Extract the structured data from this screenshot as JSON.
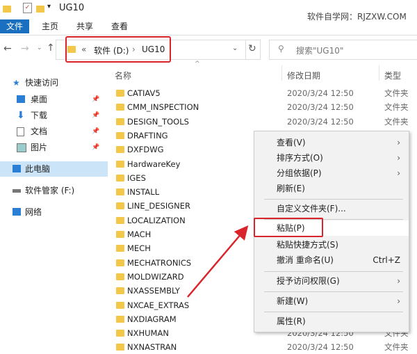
{
  "title_bar": {
    "title": "UG10",
    "watermark": "软件自学网：RJZXW.COM"
  },
  "ribbon": {
    "tabs": [
      "文件",
      "主页",
      "共享",
      "查看"
    ]
  },
  "address": {
    "prefix": "«",
    "segments": [
      "软件 (D:)",
      "UG10"
    ],
    "search_placeholder": "搜索\"UG10\""
  },
  "columns": {
    "name": "名称",
    "date": "修改日期",
    "type": "类型"
  },
  "sidebar": {
    "items": [
      {
        "label": "快速访问",
        "icon": "star-icon"
      },
      {
        "label": "桌面",
        "icon": "desktop-icon",
        "pinned": true
      },
      {
        "label": "下载",
        "icon": "download-icon",
        "pinned": true
      },
      {
        "label": "文档",
        "icon": "document-icon",
        "pinned": true
      },
      {
        "label": "图片",
        "icon": "picture-icon",
        "pinned": true
      },
      {
        "label": "此电脑",
        "icon": "computer-icon"
      },
      {
        "label": "软件管家 (F:)",
        "icon": "drive-icon"
      },
      {
        "label": "网络",
        "icon": "network-icon"
      }
    ]
  },
  "files": [
    {
      "name": "CATIAV5",
      "date": "2020/3/24 12:50",
      "type": "文件夹"
    },
    {
      "name": "CMM_INSPECTION",
      "date": "2020/3/24 12:50",
      "type": "文件夹"
    },
    {
      "name": "DESIGN_TOOLS",
      "date": "2020/3/24 12:50",
      "type": "文件夹"
    },
    {
      "name": "DRAFTING",
      "date": "2020/3/24 12:50",
      "type": "文件夹"
    },
    {
      "name": "DXFDWG",
      "date": "2020/3/24 12:50",
      "type": "文件夹"
    },
    {
      "name": "HardwareKey",
      "date": "",
      "type": ""
    },
    {
      "name": "IGES",
      "date": "",
      "type": ""
    },
    {
      "name": "INSTALL",
      "date": "",
      "type": ""
    },
    {
      "name": "LINE_DESIGNER",
      "date": "",
      "type": ""
    },
    {
      "name": "LOCALIZATION",
      "date": "",
      "type": ""
    },
    {
      "name": "MACH",
      "date": "",
      "type": ""
    },
    {
      "name": "MECH",
      "date": "",
      "type": ""
    },
    {
      "name": "MECHATRONICS",
      "date": "",
      "type": ""
    },
    {
      "name": "MOLDWIZARD",
      "date": "",
      "type": ""
    },
    {
      "name": "NXASSEMBLY",
      "date": "",
      "type": ""
    },
    {
      "name": "NXCAE_EXTRAS",
      "date": "",
      "type": ""
    },
    {
      "name": "NXDIAGRAM",
      "date": "",
      "type": ""
    },
    {
      "name": "NXHUMAN",
      "date": "2020/3/24 12:50",
      "type": "文件夹"
    },
    {
      "name": "NXNASTRAN",
      "date": "2020/3/24 12:50",
      "type": "文件夹"
    }
  ],
  "context_menu": {
    "items": [
      {
        "label": "查看(V)",
        "submenu": true
      },
      {
        "label": "排序方式(O)",
        "submenu": true
      },
      {
        "label": "分组依据(P)",
        "submenu": true
      },
      {
        "label": "刷新(E)"
      },
      {
        "label": "自定义文件夹(F)..."
      },
      {
        "label": "粘贴(P)",
        "highlighted": true
      },
      {
        "label": "粘贴快捷方式(S)"
      },
      {
        "label": "撤消 重命名(U)",
        "shortcut": "Ctrl+Z"
      },
      {
        "label": "授予访问权限(G)",
        "submenu": true
      },
      {
        "label": "新建(W)",
        "submenu": true
      },
      {
        "label": "属性(R)"
      }
    ]
  },
  "colors": {
    "accent": "#1a6fc0",
    "highlight": "#d9242c"
  }
}
